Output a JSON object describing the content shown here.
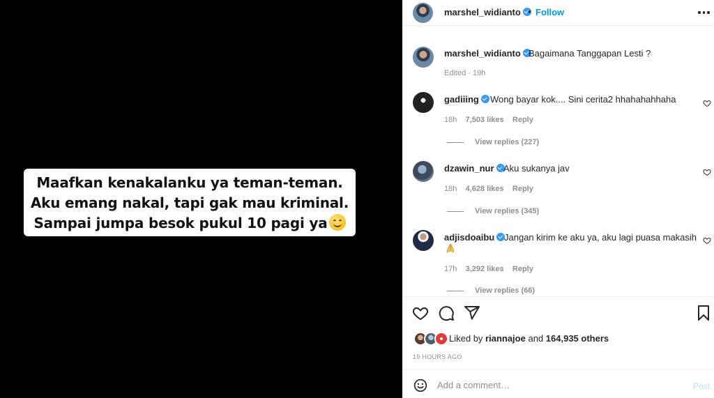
{
  "media": {
    "caption_lines": [
      "Maafkan kenakalanku ya teman-teman.",
      "Aku emang nakal, tapi gak mau kriminal.",
      "Sampai jumpa besok pukul 10 pagi ya"
    ],
    "emoji": "smiling-face-emoji"
  },
  "header": {
    "username": "marshel_widianto",
    "dot": "•",
    "follow_label": "Follow",
    "more_icon": "more-horizontal-icon"
  },
  "caption": {
    "username": "marshel_widianto",
    "text": "Bagaimana Tanggapan Lesti ?",
    "edited": "Edited",
    "time": "19h"
  },
  "comments": [
    {
      "username": "gadiiing",
      "text": "Wong bayar kok.... Sini cerita2 hhahahahhaha",
      "time": "18h",
      "likes": "7,503 likes",
      "reply_label": "Reply",
      "view_replies": "View replies (227)"
    },
    {
      "username": "dzawin_nur",
      "text": "Aku sukanya jav",
      "time": "18h",
      "likes": "4,628 likes",
      "reply_label": "Reply",
      "view_replies": "View replies (345)"
    },
    {
      "username": "adjisdoaibu",
      "text": "Jangan kirim ke aku ya, aku lagi puasa makasih",
      "time": "17h",
      "likes": "3,292 likes",
      "reply_label": "Reply",
      "view_replies": "View replies (66)"
    }
  ],
  "actions": {
    "liked_by_prefix": "Liked by",
    "liked_by_user": "riannajoe",
    "liked_and": "and",
    "liked_others": "164,935 others",
    "timestamp": "19 HOURS AGO"
  },
  "comment_box": {
    "placeholder": "Add a comment…",
    "post_label": "Post"
  },
  "colors": {
    "accent": "#0095f6",
    "verified": "#3897f0",
    "muted": "#8e8e8e",
    "post_disabled": "#b2dffc"
  }
}
